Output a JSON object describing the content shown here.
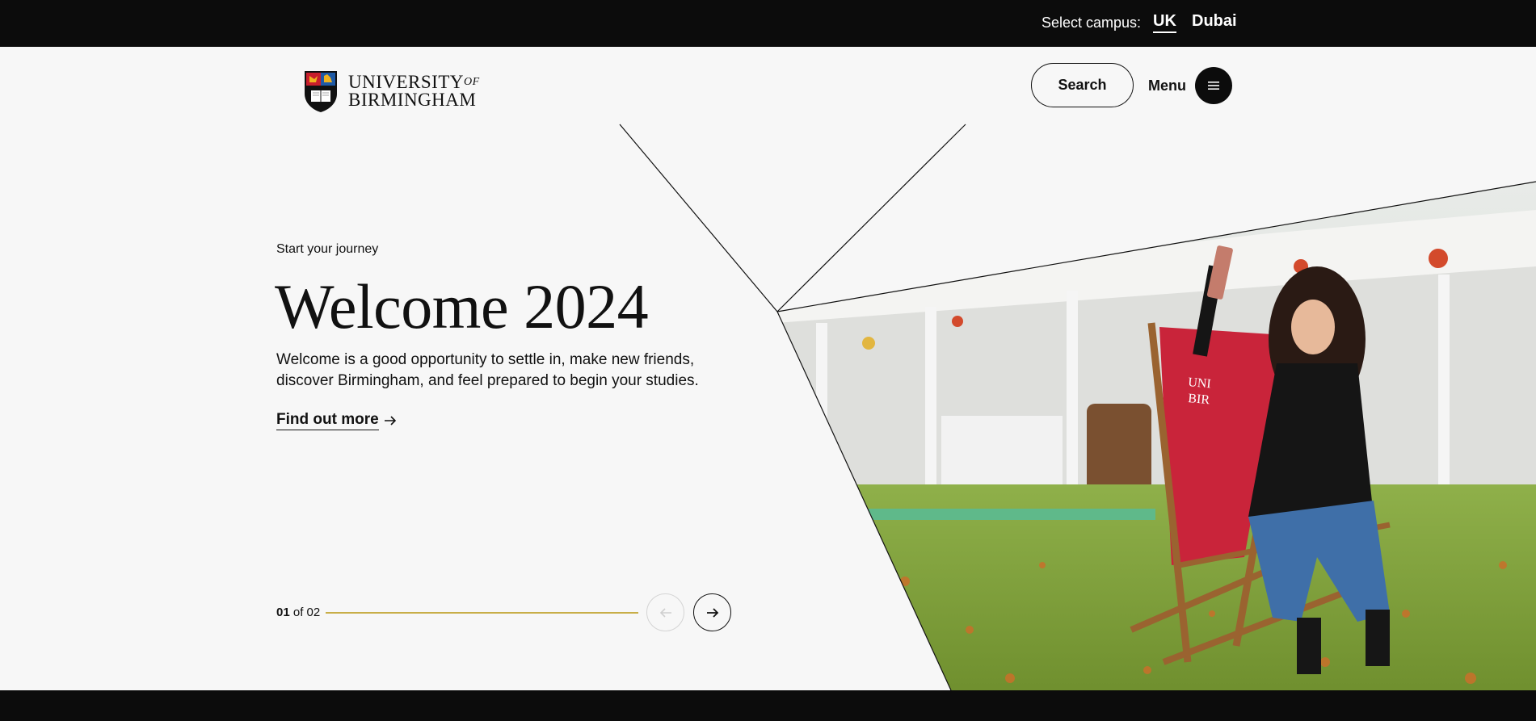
{
  "topbar": {
    "campus_label": "Select campus:",
    "campus_options": [
      "UK",
      "Dubai"
    ],
    "selected_campus": "UK"
  },
  "header": {
    "logo_line1": "UNIVERSITY",
    "logo_of": "OF",
    "logo_line2": "BIRMINGHAM",
    "search_label": "Search",
    "menu_label": "Menu"
  },
  "hero": {
    "kicker": "Start your journey",
    "title": "Welcome 2024",
    "description": "Welcome is a good opportunity to settle in, make new friends, discover Birmingham, and feel prepared to begin your studies.",
    "cta_label": "Find out more",
    "image_chair_text": "UNIVERSITY OF BIRMINGHAM"
  },
  "slider": {
    "current": "01",
    "of_label": "of",
    "total": "02",
    "progress_fraction": 1.0
  },
  "colors": {
    "dark": "#0c0c0c",
    "background": "#f7f7f7",
    "accent_gold": "#c8ae48",
    "chair_red": "#c9243a",
    "shield_blue": "#1f5aa6",
    "shield_red": "#c81e2c",
    "shield_gold": "#f0b21e"
  },
  "icons": {
    "menu": "hamburger-icon",
    "cta": "arrow-right-icon",
    "prev": "arrow-left-icon",
    "next": "arrow-right-icon",
    "crest": "university-crest-icon"
  }
}
